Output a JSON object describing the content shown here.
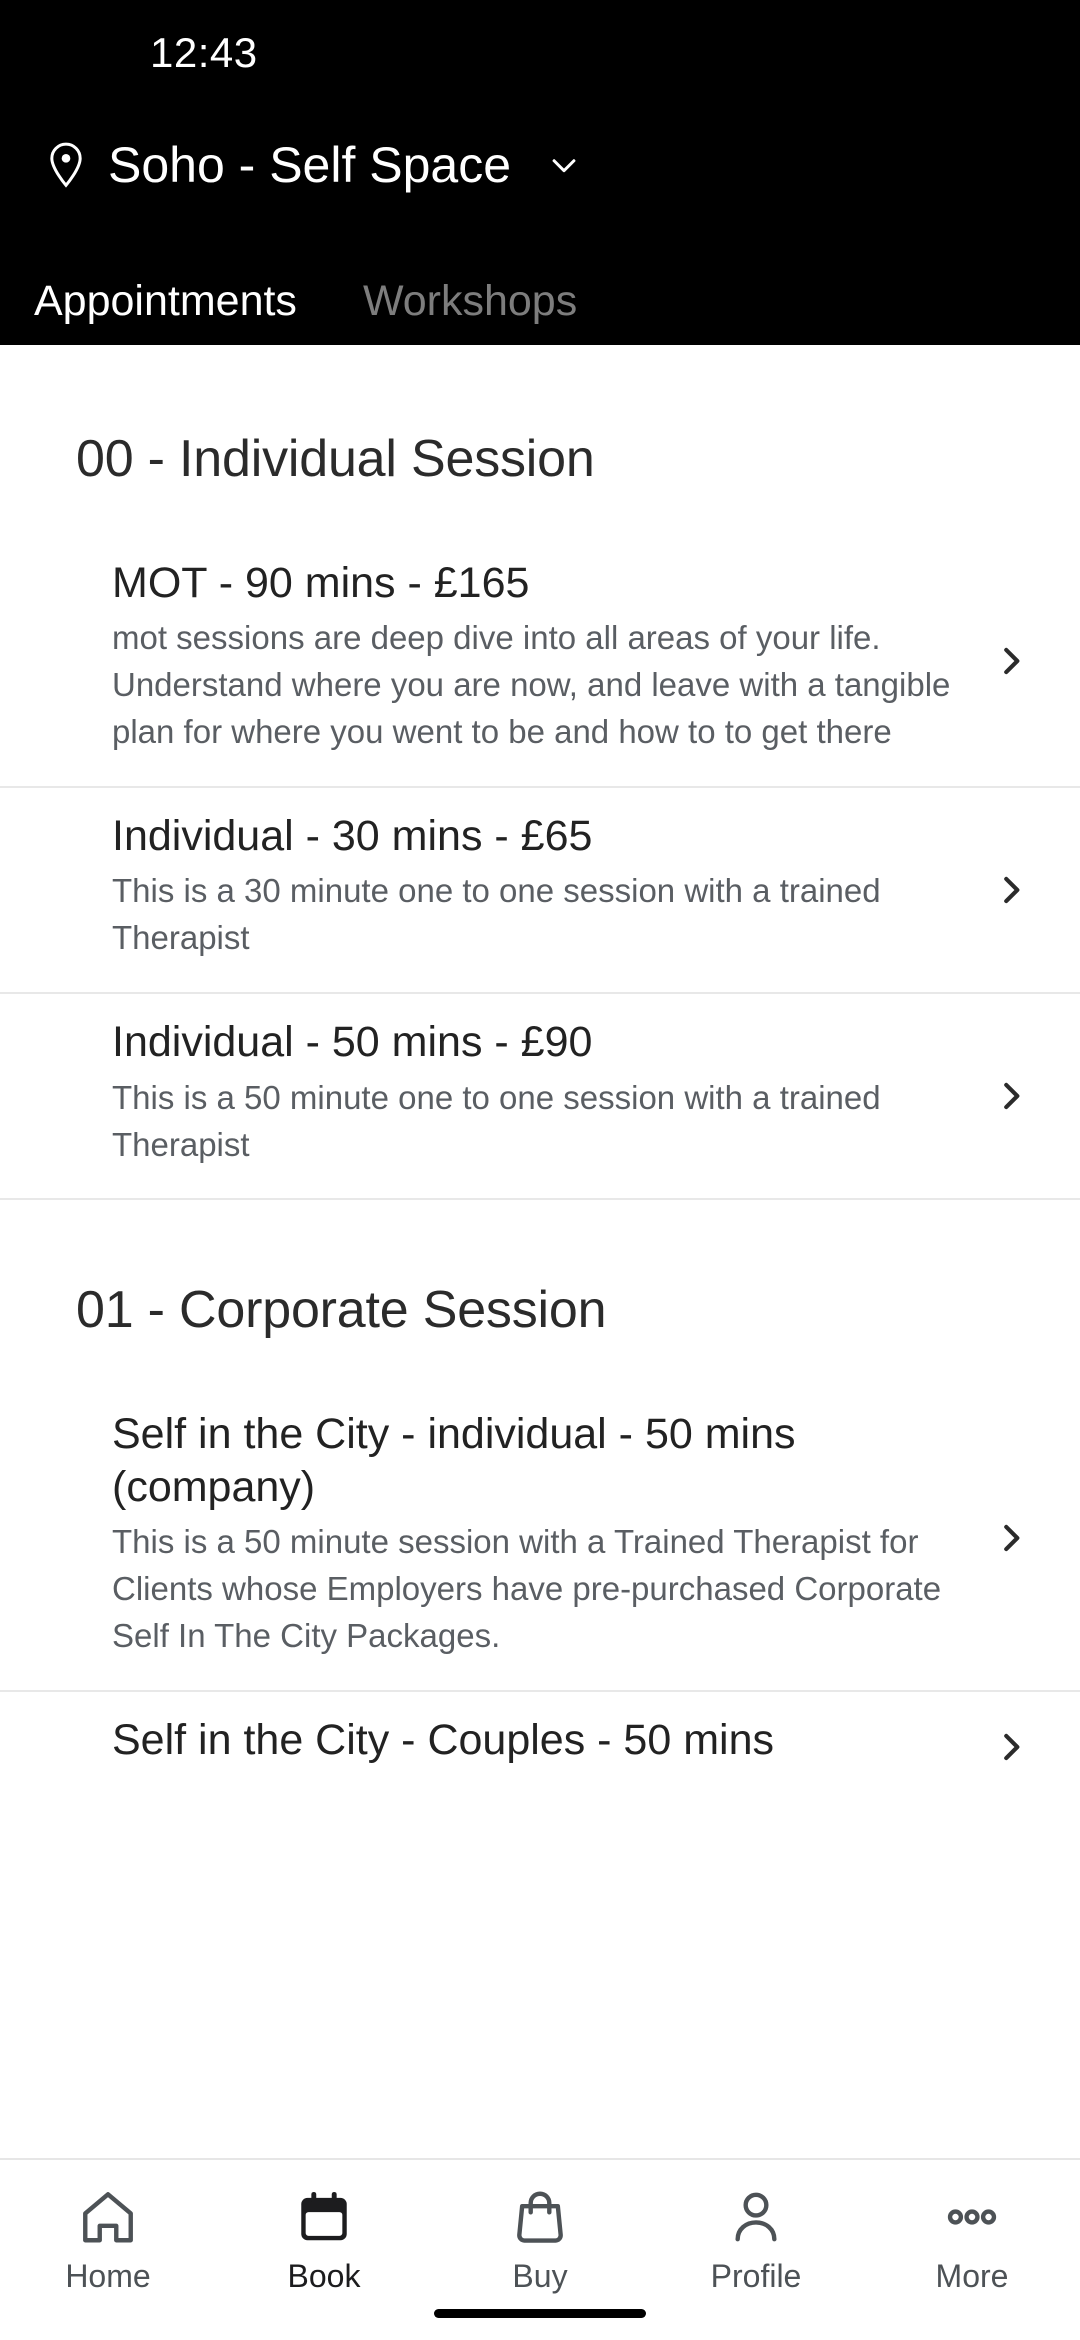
{
  "status_bar": {
    "time": "12:43"
  },
  "header": {
    "location_icon": "map-pin-icon",
    "location_name": "Soho - Self Space",
    "location_chevron_icon": "chevron-down-icon"
  },
  "tabs": [
    {
      "label": "Appointments",
      "active": true
    },
    {
      "label": "Workshops",
      "active": false
    }
  ],
  "sections": [
    {
      "title": "00 - Individual Session",
      "items": [
        {
          "title": "MOT - 90 mins - £165",
          "description": "mot sessions are deep dive into all areas of your life. Understand where you are now, and leave with a tangible plan for where you went to be and how to to get there",
          "chevron_icon": "chevron-right-icon"
        },
        {
          "title": "Individual - 30 mins - £65",
          "description": "This is a 30 minute one to one session with a trained Therapist",
          "chevron_icon": "chevron-right-icon"
        },
        {
          "title": "Individual - 50 mins - £90",
          "description": "This is a 50 minute one to one session with a trained Therapist",
          "chevron_icon": "chevron-right-icon"
        }
      ]
    },
    {
      "title": "01 - Corporate Session",
      "items": [
        {
          "title": "Self in the City - individual - 50 mins (company)",
          "description": "This is a 50 minute session with a Trained Therapist for Clients whose Employers have pre-purchased Corporate Self In The City Packages.",
          "chevron_icon": "chevron-right-icon"
        },
        {
          "title": "Self in the City - Couples - 50 mins",
          "description": "",
          "chevron_icon": "chevron-right-icon"
        }
      ]
    }
  ],
  "bottom_nav": [
    {
      "label": "Home",
      "icon": "home-icon",
      "active": false
    },
    {
      "label": "Book",
      "icon": "calendar-icon",
      "active": true
    },
    {
      "label": "Buy",
      "icon": "shopping-bag-icon",
      "active": false
    },
    {
      "label": "Profile",
      "icon": "person-icon",
      "active": false
    },
    {
      "label": "More",
      "icon": "ellipsis-icon",
      "active": false
    }
  ],
  "colors": {
    "header_bg": "#000000",
    "page_bg": "#ffffff",
    "active_tab": "#ffffff",
    "inactive_tab": "#7d7d7d",
    "title_text": "#222222",
    "desc_text": "#5a5e63",
    "divider": "#e8e8e8"
  }
}
